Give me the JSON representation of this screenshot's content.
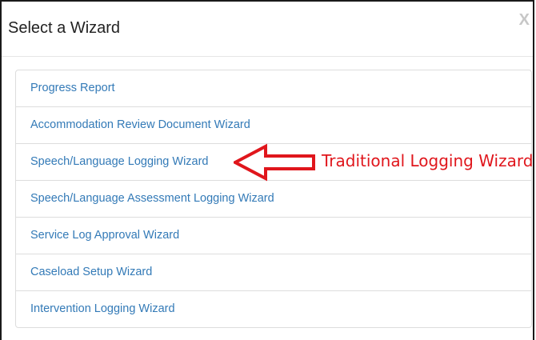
{
  "dialog": {
    "title": "Select a Wizard",
    "close_label": "X"
  },
  "wizards": [
    {
      "label": "Progress Report"
    },
    {
      "label": "Accommodation Review Document Wizard"
    },
    {
      "label": "Speech/Language Logging Wizard"
    },
    {
      "label": "Speech/Language Assessment Logging Wizard"
    },
    {
      "label": "Service Log Approval Wizard"
    },
    {
      "label": "Caseload Setup Wizard"
    },
    {
      "label": "Intervention Logging Wizard"
    }
  ],
  "annotation": {
    "text": "Traditional Logging Wizard",
    "arrow_icon": "left-arrow-icon",
    "color": "#e0161c"
  },
  "colors": {
    "link": "#337ab7",
    "border": "#dddddd"
  }
}
